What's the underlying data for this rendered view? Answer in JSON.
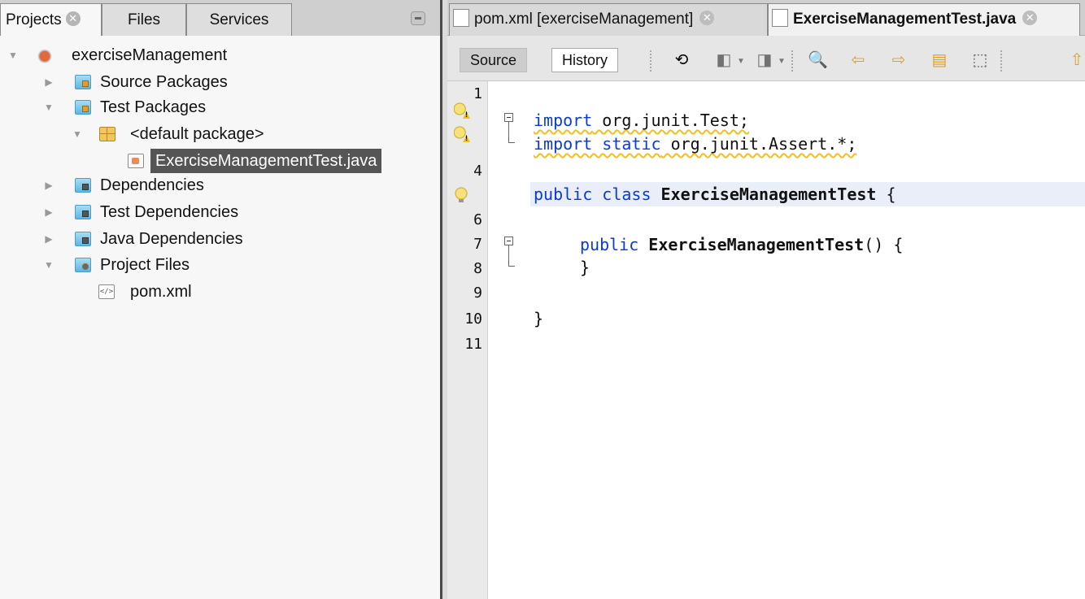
{
  "projects_panel": {
    "tabs": [
      {
        "label": "Projects",
        "active": true
      },
      {
        "label": "Files",
        "active": false
      },
      {
        "label": "Services",
        "active": false
      }
    ],
    "tree": {
      "project": "exerciseManagement",
      "source_packages": "Source Packages",
      "test_packages": "Test Packages",
      "default_package": "<default package>",
      "selected_file": "ExerciseManagementTest.java",
      "dependencies": "Dependencies",
      "test_dependencies": "Test Dependencies",
      "java_dependencies": "Java Dependencies",
      "project_files": "Project Files",
      "pom": "pom.xml"
    }
  },
  "editor": {
    "tabs": [
      {
        "label": "pom.xml [exerciseManagement]",
        "active": false
      },
      {
        "label": "ExerciseManagementTest.java",
        "active": true
      }
    ],
    "toolbar": {
      "source_label": "Source",
      "history_label": "History",
      "icons": [
        "last-edit-icon",
        "back-icon",
        "forward-icon",
        "find-icon",
        "find-previous-icon",
        "find-next-icon",
        "toggle-highlight-icon",
        "toggle-rectangular-selection-icon",
        "bookmark-icon"
      ]
    },
    "line_numbers": [
      "1",
      "",
      "",
      "4",
      "",
      "6",
      "7",
      "8",
      "9",
      "10",
      "11"
    ],
    "code": {
      "l2_kw": "import",
      "l2_rest": " org.junit.Test;",
      "l3_kw": "import static",
      "l3_rest": " org.junit.Assert.*;",
      "l5_kw": "public class",
      "l5_name": "ExerciseManagementTest",
      "l5_rest": " {",
      "l7_kw": "public",
      "l7_name": "ExerciseManagementTest",
      "l7_rest": "() {",
      "l8": "}",
      "l10": "}"
    },
    "colors": {
      "keyword": "#0b3bd6",
      "highlight_row": "#e9eef8",
      "warning_underline": "#f0c020"
    }
  }
}
